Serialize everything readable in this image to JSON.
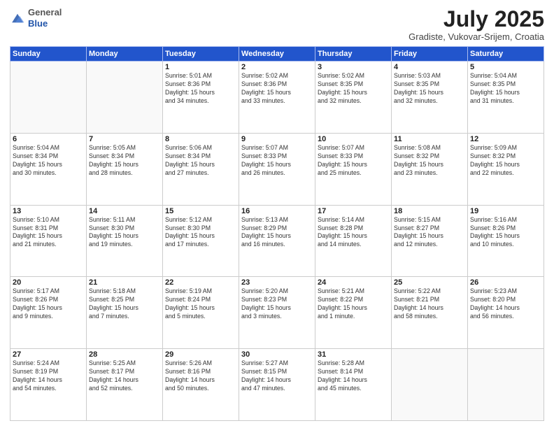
{
  "header": {
    "logo_line1": "General",
    "logo_line2": "Blue",
    "title": "July 2025",
    "subtitle": "Gradiste, Vukovar-Srijem, Croatia"
  },
  "weekdays": [
    "Sunday",
    "Monday",
    "Tuesday",
    "Wednesday",
    "Thursday",
    "Friday",
    "Saturday"
  ],
  "weeks": [
    [
      {
        "day": "",
        "detail": ""
      },
      {
        "day": "",
        "detail": ""
      },
      {
        "day": "1",
        "detail": "Sunrise: 5:01 AM\nSunset: 8:36 PM\nDaylight: 15 hours\nand 34 minutes."
      },
      {
        "day": "2",
        "detail": "Sunrise: 5:02 AM\nSunset: 8:36 PM\nDaylight: 15 hours\nand 33 minutes."
      },
      {
        "day": "3",
        "detail": "Sunrise: 5:02 AM\nSunset: 8:35 PM\nDaylight: 15 hours\nand 32 minutes."
      },
      {
        "day": "4",
        "detail": "Sunrise: 5:03 AM\nSunset: 8:35 PM\nDaylight: 15 hours\nand 32 minutes."
      },
      {
        "day": "5",
        "detail": "Sunrise: 5:04 AM\nSunset: 8:35 PM\nDaylight: 15 hours\nand 31 minutes."
      }
    ],
    [
      {
        "day": "6",
        "detail": "Sunrise: 5:04 AM\nSunset: 8:34 PM\nDaylight: 15 hours\nand 30 minutes."
      },
      {
        "day": "7",
        "detail": "Sunrise: 5:05 AM\nSunset: 8:34 PM\nDaylight: 15 hours\nand 28 minutes."
      },
      {
        "day": "8",
        "detail": "Sunrise: 5:06 AM\nSunset: 8:34 PM\nDaylight: 15 hours\nand 27 minutes."
      },
      {
        "day": "9",
        "detail": "Sunrise: 5:07 AM\nSunset: 8:33 PM\nDaylight: 15 hours\nand 26 minutes."
      },
      {
        "day": "10",
        "detail": "Sunrise: 5:07 AM\nSunset: 8:33 PM\nDaylight: 15 hours\nand 25 minutes."
      },
      {
        "day": "11",
        "detail": "Sunrise: 5:08 AM\nSunset: 8:32 PM\nDaylight: 15 hours\nand 23 minutes."
      },
      {
        "day": "12",
        "detail": "Sunrise: 5:09 AM\nSunset: 8:32 PM\nDaylight: 15 hours\nand 22 minutes."
      }
    ],
    [
      {
        "day": "13",
        "detail": "Sunrise: 5:10 AM\nSunset: 8:31 PM\nDaylight: 15 hours\nand 21 minutes."
      },
      {
        "day": "14",
        "detail": "Sunrise: 5:11 AM\nSunset: 8:30 PM\nDaylight: 15 hours\nand 19 minutes."
      },
      {
        "day": "15",
        "detail": "Sunrise: 5:12 AM\nSunset: 8:30 PM\nDaylight: 15 hours\nand 17 minutes."
      },
      {
        "day": "16",
        "detail": "Sunrise: 5:13 AM\nSunset: 8:29 PM\nDaylight: 15 hours\nand 16 minutes."
      },
      {
        "day": "17",
        "detail": "Sunrise: 5:14 AM\nSunset: 8:28 PM\nDaylight: 15 hours\nand 14 minutes."
      },
      {
        "day": "18",
        "detail": "Sunrise: 5:15 AM\nSunset: 8:27 PM\nDaylight: 15 hours\nand 12 minutes."
      },
      {
        "day": "19",
        "detail": "Sunrise: 5:16 AM\nSunset: 8:26 PM\nDaylight: 15 hours\nand 10 minutes."
      }
    ],
    [
      {
        "day": "20",
        "detail": "Sunrise: 5:17 AM\nSunset: 8:26 PM\nDaylight: 15 hours\nand 9 minutes."
      },
      {
        "day": "21",
        "detail": "Sunrise: 5:18 AM\nSunset: 8:25 PM\nDaylight: 15 hours\nand 7 minutes."
      },
      {
        "day": "22",
        "detail": "Sunrise: 5:19 AM\nSunset: 8:24 PM\nDaylight: 15 hours\nand 5 minutes."
      },
      {
        "day": "23",
        "detail": "Sunrise: 5:20 AM\nSunset: 8:23 PM\nDaylight: 15 hours\nand 3 minutes."
      },
      {
        "day": "24",
        "detail": "Sunrise: 5:21 AM\nSunset: 8:22 PM\nDaylight: 15 hours\nand 1 minute."
      },
      {
        "day": "25",
        "detail": "Sunrise: 5:22 AM\nSunset: 8:21 PM\nDaylight: 14 hours\nand 58 minutes."
      },
      {
        "day": "26",
        "detail": "Sunrise: 5:23 AM\nSunset: 8:20 PM\nDaylight: 14 hours\nand 56 minutes."
      }
    ],
    [
      {
        "day": "27",
        "detail": "Sunrise: 5:24 AM\nSunset: 8:19 PM\nDaylight: 14 hours\nand 54 minutes."
      },
      {
        "day": "28",
        "detail": "Sunrise: 5:25 AM\nSunset: 8:17 PM\nDaylight: 14 hours\nand 52 minutes."
      },
      {
        "day": "29",
        "detail": "Sunrise: 5:26 AM\nSunset: 8:16 PM\nDaylight: 14 hours\nand 50 minutes."
      },
      {
        "day": "30",
        "detail": "Sunrise: 5:27 AM\nSunset: 8:15 PM\nDaylight: 14 hours\nand 47 minutes."
      },
      {
        "day": "31",
        "detail": "Sunrise: 5:28 AM\nSunset: 8:14 PM\nDaylight: 14 hours\nand 45 minutes."
      },
      {
        "day": "",
        "detail": ""
      },
      {
        "day": "",
        "detail": ""
      }
    ]
  ]
}
